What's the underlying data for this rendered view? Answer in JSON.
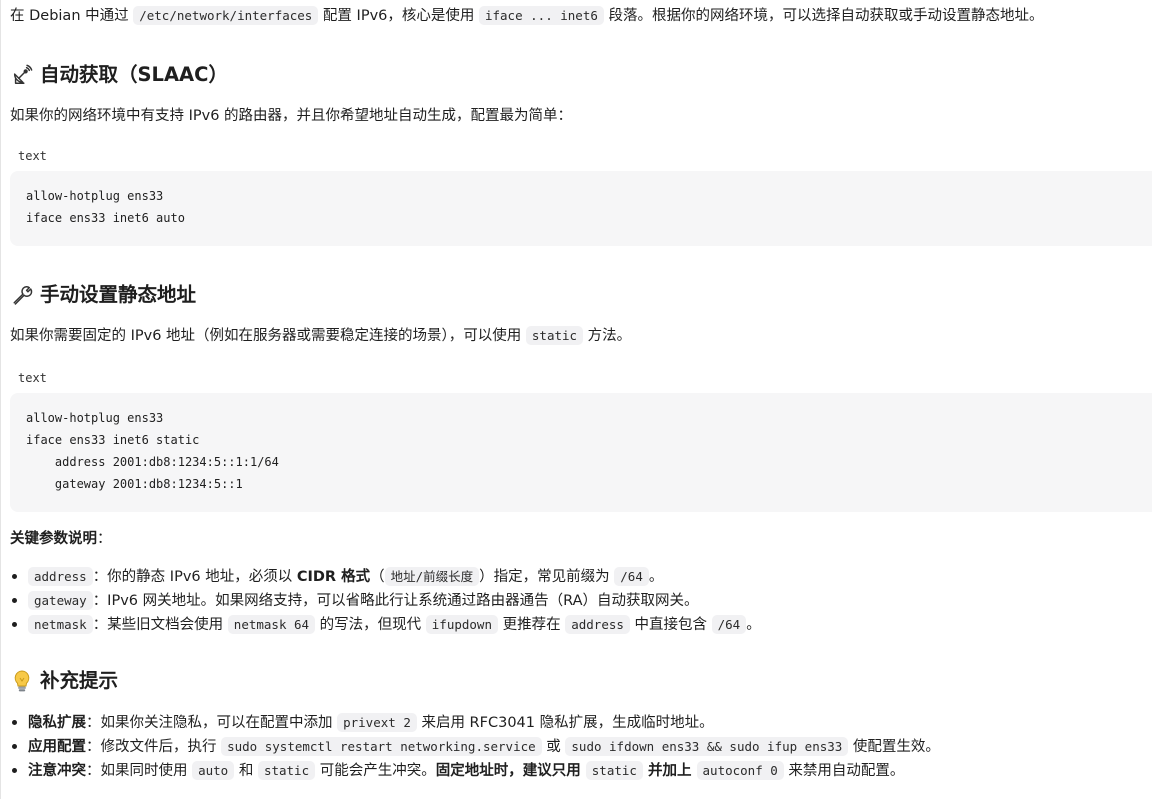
{
  "intro": {
    "t1": "在 Debian 中通过 ",
    "c1": "/etc/network/interfaces",
    "t2": " 配置 IPv6，核心是使用 ",
    "c2": "iface ... inet6",
    "t3": " 段落。根据你的网络环境，可以选择自动获取或手动设置静态地址。"
  },
  "slaac": {
    "heading": "自动获取（SLAAC）",
    "icon": "satellite-dish-icon",
    "para": "如果你的网络环境中有支持 IPv6 的路由器，并且你希望地址自动生成，配置最为简单：",
    "code_lang": "text",
    "code": "allow-hotplug ens33\niface ens33 inet6 auto"
  },
  "static": {
    "heading": "手动设置静态地址",
    "icon": "wrench-icon",
    "para_t1": "如果你需要固定的 IPv6 地址（例如在服务器或需要稳定连接的场景），可以使用 ",
    "para_c1": "static",
    "para_t2": " 方法。",
    "code_lang": "text",
    "code": "allow-hotplug ens33\niface ens33 inet6 static\n    address 2001:db8:1234:5::1:1/64\n    gateway 2001:db8:1234:5::1"
  },
  "params": {
    "title": "关键参数说明",
    "colon": "：",
    "items": [
      {
        "code": "address",
        "t1": "：你的静态 IPv6 地址，必须以 ",
        "bold": "CIDR 格式",
        "t2": "（",
        "code2": "地址/前缀长度",
        "t3": "）指定，常见前缀为 ",
        "code3": "/64",
        "t4": "。"
      },
      {
        "code": "gateway",
        "t1": "：IPv6 网关地址。如果网络支持，可以省略此行让系统通过路由器通告（RA）自动获取网关。"
      },
      {
        "code": "netmask",
        "t1": "：某些旧文档会使用 ",
        "code2": "netmask 64",
        "t2": " 的写法，但现代 ",
        "code3": "ifupdown",
        "t3": " 更推荐在 ",
        "code4": "address",
        "t4": " 中直接包含 ",
        "code5": "/64",
        "t5": "。"
      }
    ]
  },
  "tips": {
    "heading": "补充提示",
    "icon": "lightbulb-icon",
    "items": [
      {
        "bold": "隐私扩展",
        "t1": "：如果你关注隐私，可以在配置中添加 ",
        "code": "privext 2",
        "t2": " 来启用 RFC3041 隐私扩展，生成临时地址。"
      },
      {
        "bold": "应用配置",
        "t1": "：修改文件后，执行 ",
        "code": "sudo systemctl restart networking.service",
        "t2": " 或 ",
        "code2": "sudo ifdown ens33 && sudo ifup ens33",
        "t3": " 使配置生效。"
      },
      {
        "bold": "注意冲突",
        "t1": "：如果同时使用 ",
        "code": "auto",
        "t2": " 和 ",
        "code2": "static",
        "t3": " 可能会产生冲突。",
        "bold2": "固定地址时，建议只用 ",
        "code3": "static",
        "bold3": " 并加上 ",
        "code4": "autoconf 0",
        "t4": " 来禁用自动配置。"
      }
    ]
  }
}
